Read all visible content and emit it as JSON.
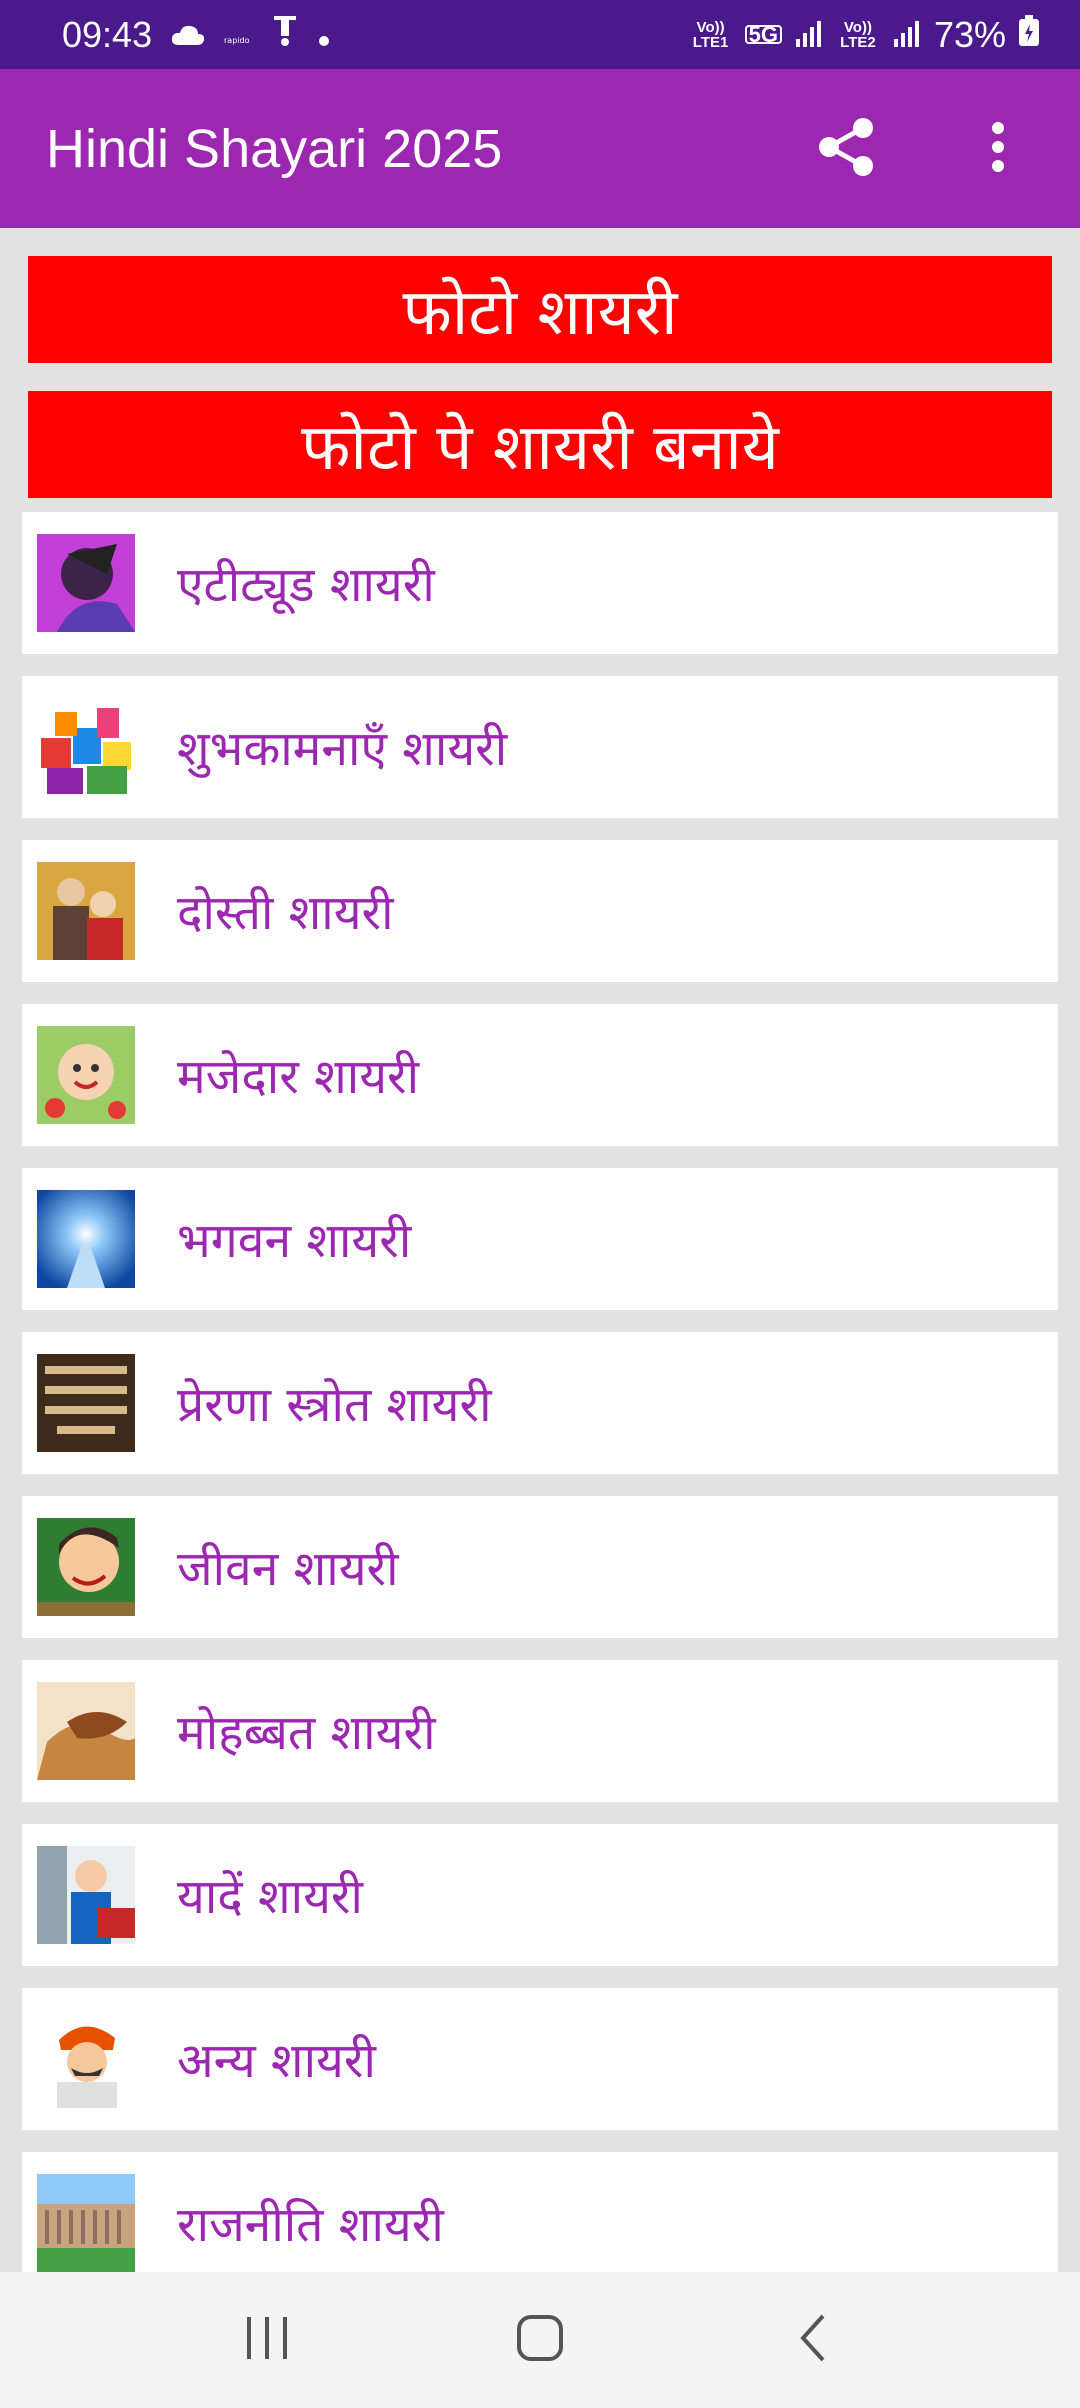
{
  "status_bar": {
    "time": "09:43",
    "network_1": "Vo)) LTE1",
    "network_type": "5G",
    "network_2": "Vo)) LTE2",
    "battery": "73%"
  },
  "app_bar": {
    "title": "Hindi Shayari 2025",
    "share_icon": "share-icon",
    "menu_icon": "more-vert-icon"
  },
  "banners": {
    "photo_shayari": "फोटो शायरी",
    "photo_pe_shayari": "फोटो पे शायरी बनाये"
  },
  "categories": [
    {
      "label": "एटीट्यूड शायरी"
    },
    {
      "label": "शुभकामनाएँ शायरी"
    },
    {
      "label": "दोस्ती शायरी"
    },
    {
      "label": "मजेदार शायरी"
    },
    {
      "label": "भगवन शायरी"
    },
    {
      "label": "प्रेरणा स्त्रोत शायरी"
    },
    {
      "label": "जीवन शायरी"
    },
    {
      "label": "मोहब्बत शायरी"
    },
    {
      "label": "यादें शायरी"
    },
    {
      "label": "अन्य शायरी"
    },
    {
      "label": "राजनीति शायरी"
    }
  ],
  "nav_bar": {
    "recents_icon": "recents-icon",
    "home_icon": "home-icon",
    "back_icon": "back-icon"
  },
  "colors": {
    "status_bar": "#4a1a8c",
    "app_bar": "#9c27b0",
    "banner": "#ff0000",
    "item_text": "#9c27b0"
  }
}
